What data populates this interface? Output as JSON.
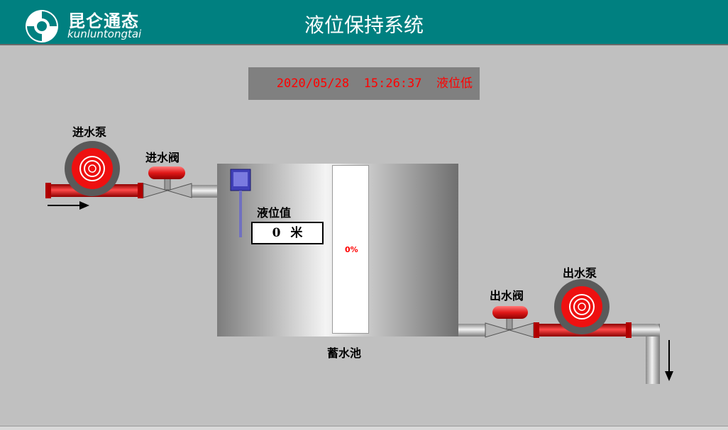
{
  "header": {
    "brand_cn": "昆仑通态",
    "brand_en": "kunluntongtai",
    "title": "液位保持系统"
  },
  "status": {
    "date": "2020/05/28",
    "time": "15:26:37",
    "message": "液位低"
  },
  "labels": {
    "inlet_pump": "进水泵",
    "inlet_valve": "进水阀",
    "outlet_valve": "出水阀",
    "outlet_pump": "出水泵",
    "tank": "蓄水池",
    "level_title": "液位值"
  },
  "level": {
    "value": "0",
    "unit": "米",
    "percent_text": "0%",
    "fraction": 0
  },
  "colors": {
    "header": "#008080",
    "pipe_red": "#e01010",
    "valve_red": "#e82020",
    "alarm_text": "#ff0000"
  },
  "icons": [
    "logo-icon",
    "pump-icon",
    "valve-icon",
    "level-sensor-icon",
    "flow-arrow-icon"
  ]
}
